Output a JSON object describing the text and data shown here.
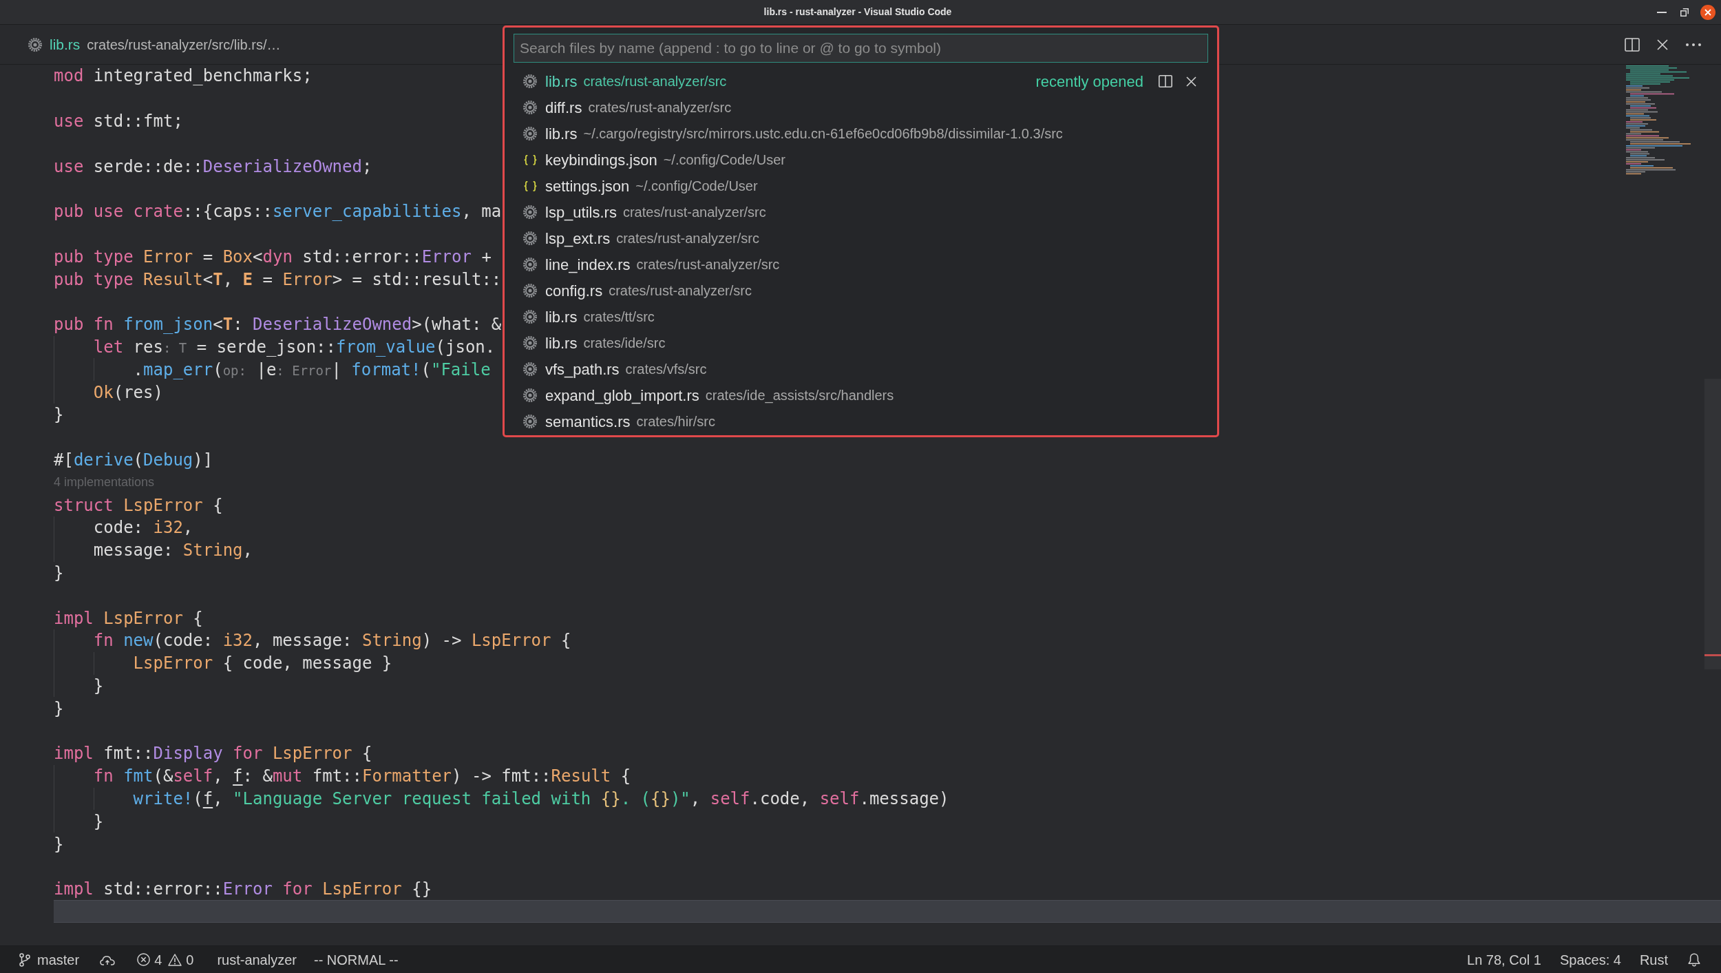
{
  "window": {
    "title": "lib.rs - rust-analyzer - Visual Studio Code"
  },
  "editor_title": {
    "file": "lib.rs",
    "path": "crates/rust-analyzer/src/lib.rs/…"
  },
  "editor": {
    "lines": [
      {
        "kind": "code",
        "current": false,
        "tokens": [
          {
            "kind": "keyword",
            "text": "mod"
          },
          {
            "kind": "plain",
            "text": " integrated_benchmarks;"
          }
        ]
      },
      {
        "kind": "blank",
        "current": false
      },
      {
        "kind": "code",
        "current": false,
        "tokens": [
          {
            "kind": "keyword",
            "text": "use"
          },
          {
            "kind": "plain",
            "text": " std::fmt;"
          }
        ]
      },
      {
        "kind": "blank",
        "current": false
      },
      {
        "kind": "code",
        "current": false,
        "tokens": [
          {
            "kind": "keyword",
            "text": "use"
          },
          {
            "kind": "plain",
            "text": " serde::de::"
          },
          {
            "kind": "trait",
            "text": "DeserializeOwned"
          },
          {
            "kind": "plain",
            "text": ";"
          }
        ]
      },
      {
        "kind": "blank",
        "current": false
      },
      {
        "kind": "code",
        "current": false,
        "tokens": [
          {
            "kind": "keyword",
            "text": "pub"
          },
          {
            "kind": "keyword",
            "text": " use"
          },
          {
            "kind": "keyword",
            "text": " crate"
          },
          {
            "kind": "plain",
            "text": "::{caps::"
          },
          {
            "kind": "function",
            "text": "server_capabilities"
          },
          {
            "kind": "plain",
            "text": ", ma"
          }
        ]
      },
      {
        "kind": "blank",
        "current": false
      },
      {
        "kind": "code",
        "current": false,
        "tokens": [
          {
            "kind": "keyword",
            "text": "pub"
          },
          {
            "kind": "keyword",
            "text": " type"
          },
          {
            "kind": "type",
            "text": " Error"
          },
          {
            "kind": "plain",
            "text": " = "
          },
          {
            "kind": "type",
            "text": "Box"
          },
          {
            "kind": "plain",
            "text": "<"
          },
          {
            "kind": "keyword",
            "text": "dyn"
          },
          {
            "kind": "plain",
            "text": " std::error::"
          },
          {
            "kind": "trait",
            "text": "Error"
          },
          {
            "kind": "plain",
            "text": " +"
          }
        ]
      },
      {
        "kind": "code",
        "current": false,
        "tokens": [
          {
            "kind": "keyword",
            "text": "pub"
          },
          {
            "kind": "keyword",
            "text": " type"
          },
          {
            "kind": "type",
            "text": " Result"
          },
          {
            "kind": "plain",
            "text": "<"
          },
          {
            "kind": "type_param",
            "text": "T"
          },
          {
            "kind": "plain",
            "text": ", "
          },
          {
            "kind": "type_param",
            "text": "E"
          },
          {
            "kind": "plain",
            "text": " = "
          },
          {
            "kind": "type",
            "text": "Error"
          },
          {
            "kind": "plain",
            "text": "> = std::result::"
          }
        ]
      },
      {
        "kind": "blank",
        "current": false
      },
      {
        "kind": "code",
        "current": false,
        "tokens": [
          {
            "kind": "keyword",
            "text": "pub"
          },
          {
            "kind": "keyword",
            "text": " fn"
          },
          {
            "kind": "function",
            "text": " from_json"
          },
          {
            "kind": "plain",
            "text": "<"
          },
          {
            "kind": "type_param",
            "text": "T"
          },
          {
            "kind": "plain",
            "text": ": "
          },
          {
            "kind": "trait",
            "text": "DeserializeOwned"
          },
          {
            "kind": "plain",
            "text": ">(what: &"
          }
        ]
      },
      {
        "kind": "code",
        "current": false,
        "tokens": [
          {
            "kind": "keyword",
            "text": "    let"
          },
          {
            "kind": "plain",
            "text": " res"
          },
          {
            "kind": "inlay",
            "text": ": T"
          },
          {
            "kind": "plain",
            "text": " = serde_json::"
          },
          {
            "kind": "function",
            "text": "from_value"
          },
          {
            "kind": "plain",
            "text": "(json."
          }
        ]
      },
      {
        "kind": "code",
        "current": false,
        "tokens": [
          {
            "kind": "plain",
            "text": "        ."
          },
          {
            "kind": "function",
            "text": "map_err"
          },
          {
            "kind": "plain",
            "text": "("
          },
          {
            "kind": "inlay",
            "text": "op:"
          },
          {
            "kind": "plain",
            "text": " |e"
          },
          {
            "kind": "inlay",
            "text": ": Error"
          },
          {
            "kind": "plain",
            "text": "| "
          },
          {
            "kind": "function",
            "text": "format!"
          },
          {
            "kind": "plain",
            "text": "("
          },
          {
            "kind": "string",
            "text": "\"Faile"
          }
        ]
      },
      {
        "kind": "code",
        "current": false,
        "tokens": [
          {
            "kind": "type",
            "text": "    Ok"
          },
          {
            "kind": "plain",
            "text": "(res)"
          }
        ]
      },
      {
        "kind": "code",
        "current": false,
        "tokens": [
          {
            "kind": "plain",
            "text": "}"
          }
        ]
      },
      {
        "kind": "blank",
        "current": false
      },
      {
        "kind": "code",
        "current": false,
        "tokens": [
          {
            "kind": "plain",
            "text": "#["
          },
          {
            "kind": "function",
            "text": "derive"
          },
          {
            "kind": "plain",
            "text": "("
          },
          {
            "kind": "function",
            "text": "Debug"
          },
          {
            "kind": "plain",
            "text": ")]"
          }
        ]
      },
      {
        "kind": "codelens",
        "current": false,
        "text": "4 implementations"
      },
      {
        "kind": "code",
        "current": false,
        "tokens": [
          {
            "kind": "keyword",
            "text": "struct"
          },
          {
            "kind": "type",
            "text": " LspError"
          },
          {
            "kind": "plain",
            "text": " {"
          }
        ]
      },
      {
        "kind": "code",
        "current": false,
        "tokens": [
          {
            "kind": "plain",
            "text": "    code: "
          },
          {
            "kind": "type",
            "text": "i32"
          },
          {
            "kind": "plain",
            "text": ","
          }
        ]
      },
      {
        "kind": "code",
        "current": false,
        "tokens": [
          {
            "kind": "plain",
            "text": "    message: "
          },
          {
            "kind": "type",
            "text": "String"
          },
          {
            "kind": "plain",
            "text": ","
          }
        ]
      },
      {
        "kind": "code",
        "current": false,
        "tokens": [
          {
            "kind": "plain",
            "text": "}"
          }
        ]
      },
      {
        "kind": "blank",
        "current": false
      },
      {
        "kind": "code",
        "current": false,
        "tokens": [
          {
            "kind": "keyword",
            "text": "impl"
          },
          {
            "kind": "type",
            "text": " LspError"
          },
          {
            "kind": "plain",
            "text": " {"
          }
        ]
      },
      {
        "kind": "code",
        "current": false,
        "tokens": [
          {
            "kind": "keyword",
            "text": "    fn"
          },
          {
            "kind": "function",
            "text": " new"
          },
          {
            "kind": "plain",
            "text": "(code: "
          },
          {
            "kind": "type",
            "text": "i32"
          },
          {
            "kind": "plain",
            "text": ", message: "
          },
          {
            "kind": "type",
            "text": "String"
          },
          {
            "kind": "plain",
            "text": ") -> "
          },
          {
            "kind": "type",
            "text": "LspError"
          },
          {
            "kind": "plain",
            "text": " {"
          }
        ]
      },
      {
        "kind": "code",
        "current": false,
        "tokens": [
          {
            "kind": "type",
            "text": "        LspError"
          },
          {
            "kind": "plain",
            "text": " { code, message }"
          }
        ]
      },
      {
        "kind": "code",
        "current": false,
        "tokens": [
          {
            "kind": "plain",
            "text": "    }"
          }
        ]
      },
      {
        "kind": "code",
        "current": false,
        "tokens": [
          {
            "kind": "plain",
            "text": "}"
          }
        ]
      },
      {
        "kind": "blank",
        "current": false
      },
      {
        "kind": "code",
        "current": false,
        "tokens": [
          {
            "kind": "keyword",
            "text": "impl"
          },
          {
            "kind": "plain",
            "text": " fmt::"
          },
          {
            "kind": "trait",
            "text": "Display"
          },
          {
            "kind": "keyword",
            "text": " for"
          },
          {
            "kind": "type",
            "text": " LspError"
          },
          {
            "kind": "plain",
            "text": " {"
          }
        ]
      },
      {
        "kind": "code",
        "current": false,
        "tokens": [
          {
            "kind": "keyword",
            "text": "    fn"
          },
          {
            "kind": "function",
            "text": " fmt"
          },
          {
            "kind": "plain",
            "text": "(&"
          },
          {
            "kind": "keyword",
            "text": "self"
          },
          {
            "kind": "plain",
            "text": ", "
          },
          {
            "kind": "mutable",
            "text": "f"
          },
          {
            "kind": "plain",
            "text": ": &"
          },
          {
            "kind": "keyword",
            "text": "mut"
          },
          {
            "kind": "plain",
            "text": " fmt::"
          },
          {
            "kind": "type",
            "text": "Formatter"
          },
          {
            "kind": "plain",
            "text": ") -> fmt::"
          },
          {
            "kind": "type",
            "text": "Result"
          },
          {
            "kind": "plain",
            "text": " {"
          }
        ]
      },
      {
        "kind": "code",
        "current": false,
        "tokens": [
          {
            "kind": "function",
            "text": "        write!"
          },
          {
            "kind": "plain",
            "text": "("
          },
          {
            "kind": "mutable",
            "text": "f"
          },
          {
            "kind": "plain",
            "text": ", "
          },
          {
            "kind": "string",
            "text": "\"Language Server request failed with "
          },
          {
            "kind": "format",
            "text": "{}"
          },
          {
            "kind": "string",
            "text": ". ("
          },
          {
            "kind": "format",
            "text": "{}"
          },
          {
            "kind": "string",
            "text": ")\""
          },
          {
            "kind": "plain",
            "text": ", "
          },
          {
            "kind": "keyword",
            "text": "self"
          },
          {
            "kind": "plain",
            "text": ".code, "
          },
          {
            "kind": "keyword",
            "text": "self"
          },
          {
            "kind": "plain",
            "text": ".message)"
          }
        ]
      },
      {
        "kind": "code",
        "current": false,
        "tokens": [
          {
            "kind": "plain",
            "text": "    }"
          }
        ]
      },
      {
        "kind": "code",
        "current": false,
        "tokens": [
          {
            "kind": "plain",
            "text": "}"
          }
        ]
      },
      {
        "kind": "blank",
        "current": false
      },
      {
        "kind": "code",
        "current": false,
        "tokens": [
          {
            "kind": "keyword",
            "text": "impl"
          },
          {
            "kind": "plain",
            "text": " std::error::"
          },
          {
            "kind": "trait",
            "text": "Error"
          },
          {
            "kind": "keyword",
            "text": " for"
          },
          {
            "kind": "type",
            "text": " LspError"
          },
          {
            "kind": "plain",
            "text": " {}"
          }
        ]
      },
      {
        "kind": "blank",
        "current": true
      }
    ]
  },
  "quick_open": {
    "placeholder": "Search files by name (append : to go to line or @ to go to symbol)",
    "items": [
      {
        "kind": "rust",
        "label": "lib.rs",
        "path": "crates/rust-analyzer/src",
        "selected": true,
        "hint": "recently opened"
      },
      {
        "kind": "rust",
        "label": "diff.rs",
        "path": "crates/rust-analyzer/src",
        "selected": false
      },
      {
        "kind": "rust",
        "label": "lib.rs",
        "path": "~/.cargo/registry/src/mirrors.ustc.edu.cn-61ef6e0cd06fb9b8/dissimilar-1.0.3/src",
        "selected": false
      },
      {
        "kind": "json",
        "label": "keybindings.json",
        "path": "~/.config/Code/User",
        "selected": false
      },
      {
        "kind": "json",
        "label": "settings.json",
        "path": "~/.config/Code/User",
        "selected": false
      },
      {
        "kind": "rust",
        "label": "lsp_utils.rs",
        "path": "crates/rust-analyzer/src",
        "selected": false
      },
      {
        "kind": "rust",
        "label": "lsp_ext.rs",
        "path": "crates/rust-analyzer/src",
        "selected": false
      },
      {
        "kind": "rust",
        "label": "line_index.rs",
        "path": "crates/rust-analyzer/src",
        "selected": false
      },
      {
        "kind": "rust",
        "label": "config.rs",
        "path": "crates/rust-analyzer/src",
        "selected": false
      },
      {
        "kind": "rust",
        "label": "lib.rs",
        "path": "crates/tt/src",
        "selected": false
      },
      {
        "kind": "rust",
        "label": "lib.rs",
        "path": "crates/ide/src",
        "selected": false
      },
      {
        "kind": "rust",
        "label": "vfs_path.rs",
        "path": "crates/vfs/src",
        "selected": false
      },
      {
        "kind": "rust",
        "label": "expand_glob_import.rs",
        "path": "crates/ide_assists/src/handlers",
        "selected": false
      },
      {
        "kind": "rust",
        "label": "semantics.rs",
        "path": "crates/hir/src",
        "selected": false
      }
    ]
  },
  "status_bar": {
    "branch": "master",
    "errors": "4",
    "warnings": "0",
    "left_items": [
      "rust-analyzer",
      "-- NORMAL --"
    ],
    "right_items": [
      "Ln 78, Col 1",
      "Spaces: 4",
      "Rust"
    ]
  }
}
